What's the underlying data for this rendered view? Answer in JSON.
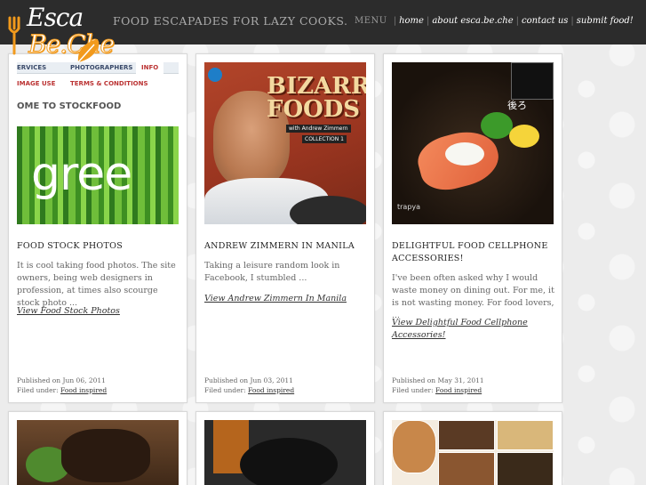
{
  "header": {
    "logo": {
      "line1": "Esca",
      "line2": "Be.Che"
    },
    "tagline": "FOOD ESCAPADES FOR LAZY COOKS.",
    "menu_label": "MENU",
    "nav": [
      "home",
      "about esca.be.che",
      "contact us",
      "submit food!"
    ]
  },
  "posts": [
    {
      "thumb": {
        "tabs": [
          "ERVICES",
          "PHOTOGRAPHERS",
          "INFO"
        ],
        "subnav": [
          "IMAGE USE",
          "TERMS & CONDITIONS"
        ],
        "welcome": "OME TO STOCKFOOD",
        "banner_word": "gree"
      },
      "title": "FOOD STOCK PHOTOS",
      "excerpt": "It is cool taking food photos. The site owners, being web designers in profession, at times also scourge stock photo ...",
      "more": "View Food Stock Photos",
      "published": "Published on Jun 06, 2011",
      "filed_label": "Filed under:",
      "category": "Food inspired"
    },
    {
      "thumb": {
        "title_line1": "BIZARRE",
        "title_line2": "FOODS",
        "subtitle": "with Andrew Zimmern",
        "collection": "COLLECTION 1"
      },
      "title": "ANDREW ZIMMERN IN MANILA",
      "excerpt": "Taking a leisure random look in Facebook, I stumbled ...",
      "more": "View Andrew Zimmern In Manila",
      "published": "Published on Jun 03, 2011",
      "filed_label": "Filed under:",
      "category": "Food inspired"
    },
    {
      "thumb": {
        "kanji": "後ろ",
        "watermark": "trapya"
      },
      "title": "DELIGHTFUL FOOD CELLPHONE ACCESSORIES!",
      "excerpt": "I've been often asked why I would waste money on dining out. For me, it is not wasting money. For food lovers, ...",
      "more": "View Delightful Food Cellphone Accessories!",
      "published": "Published on May 31, 2011",
      "filed_label": "Filed under:",
      "category": "Food inspired"
    }
  ],
  "colors": {
    "header_bg": "#2c2c2c",
    "accent_orange": "#f29a1c",
    "page_bg": "#ececec"
  }
}
